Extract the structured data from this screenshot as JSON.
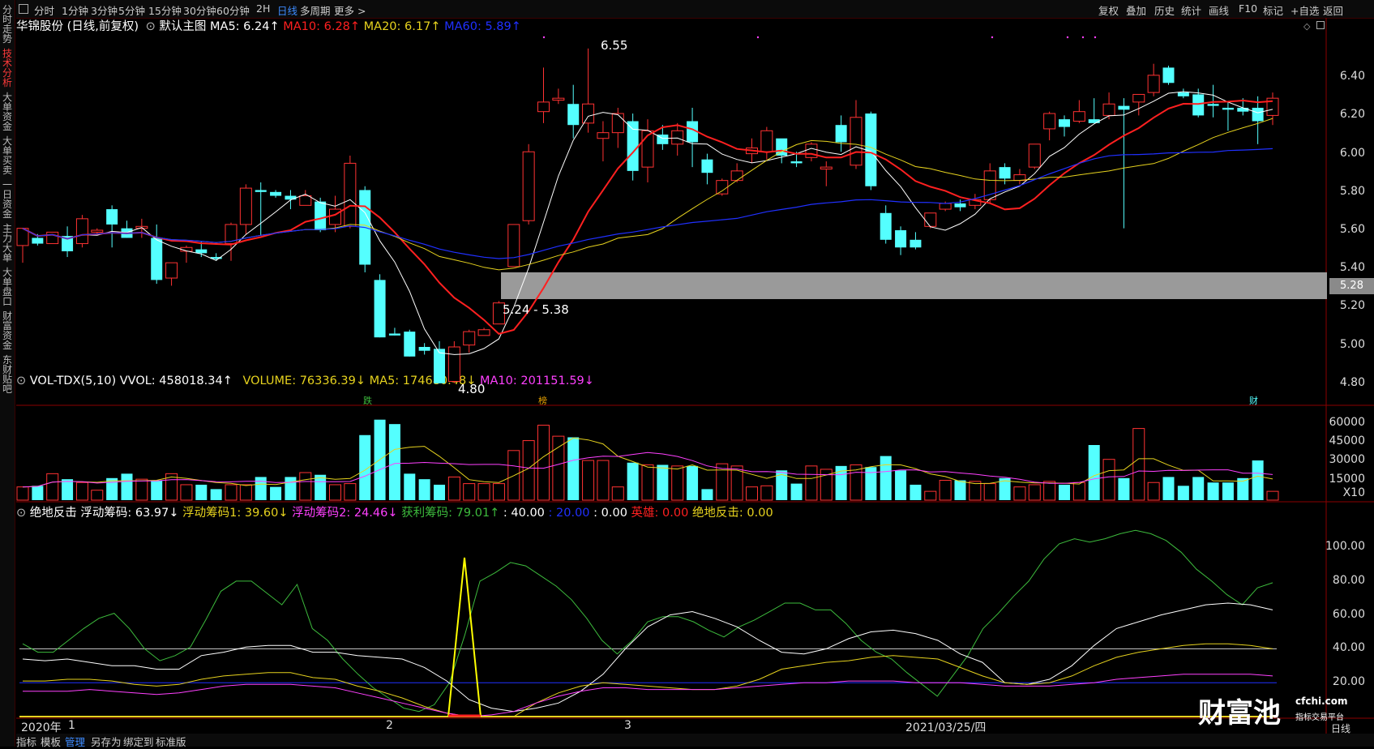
{
  "left_nav": [
    "分时走势",
    "技术分析",
    "大单资金",
    "大单买卖",
    "一日资金",
    "主力大单",
    "大单盘口",
    "财富资金",
    "东财贴吧"
  ],
  "periods": [
    "分时",
    "1分钟",
    "3分钟",
    "5分钟",
    "15分钟",
    "30分钟",
    "60分钟",
    "2H",
    "日线",
    "多周期",
    "更多 >"
  ],
  "active_period": "日线",
  "tools": [
    "复权",
    "叠加",
    "历史",
    "统计",
    "画线",
    "F10",
    "标记",
    "+自选",
    "返回"
  ],
  "header": {
    "stock": "华锦股份 (日线,前复权)",
    "main_label": "默认主图",
    "ma5": "MA5: 6.24↑",
    "ma10": "MA10: 6.28↑",
    "ma20": "MA20: 6.17↑",
    "ma60": "MA60: 5.89↑"
  },
  "vol_header": {
    "name": "VOL-TDX(5,10)",
    "vvol": "VVOL: 458018.34↑",
    "volume": "VOLUME: 76336.39↓",
    "ma5": "MA5: 174680.48↓",
    "ma10": "MA10: 201151.59↓"
  },
  "ind_header": {
    "name": "绝地反击",
    "fdcm": "浮动筹码: 63.97↓",
    "fdcm1": "浮动筹码1: 39.60↓",
    "fdcm2": "浮动筹码2: 24.46↓",
    "hlcm": "获利筹码: 79.01↑",
    "v40": ": 40.00",
    "v20": ": 20.00",
    "v0": ": 0.00",
    "yingxiong": "英雄: 0.00",
    "jdfj": "绝地反击: 0.00"
  },
  "price_axis": [
    "6.40",
    "6.20",
    "6.00",
    "5.80",
    "5.60",
    "5.40",
    "5.20",
    "5.00",
    "4.80"
  ],
  "vol_axis": [
    "60000",
    "45000",
    "30000",
    "15000",
    "X10"
  ],
  "ind_axis": [
    "100.00",
    "80.00",
    "60.00",
    "40.00",
    "20.00"
  ],
  "dates": [
    "2020年",
    "1",
    "2",
    "3",
    "2021/03/25/四"
  ],
  "price_tag": "5.28",
  "annotations": {
    "high": "6.55",
    "low": "4.80",
    "zone": "5.24 - 5.38",
    "mark1": "跌",
    "mark2": "榜",
    "mark3": "财"
  },
  "bottom_tabs": [
    "指标",
    "模板",
    "管理",
    "另存为",
    "绑定到",
    "标准版"
  ],
  "active_bottom": "管理",
  "watermark": {
    "logo": "财富池",
    "site": "cfchi.com",
    "slogan": "指标交易平台"
  },
  "right_mini": "日线",
  "colors": {
    "up": "#ff3232",
    "down": "#54ffff",
    "ma5": "#ffffff",
    "ma10": "#ff2020",
    "ma20": "#e6d21e",
    "ma60": "#2030ff",
    "magenta": "#ff40ff",
    "green": "#3dbb3d"
  },
  "chart_data": {
    "type": "candlestick",
    "title": "华锦股份 (日线,前复权)",
    "candles": [
      {
        "o": 5.52,
        "h": 5.61,
        "l": 5.43,
        "c": 5.61
      },
      {
        "o": 5.56,
        "h": 5.58,
        "l": 5.52,
        "c": 5.53
      },
      {
        "o": 5.53,
        "h": 5.59,
        "l": 5.53,
        "c": 5.59
      },
      {
        "o": 5.57,
        "h": 5.62,
        "l": 5.46,
        "c": 5.49
      },
      {
        "o": 5.53,
        "h": 5.68,
        "l": 5.51,
        "c": 5.66
      },
      {
        "o": 5.59,
        "h": 5.61,
        "l": 5.58,
        "c": 5.6
      },
      {
        "o": 5.71,
        "h": 5.73,
        "l": 5.51,
        "c": 5.63
      },
      {
        "o": 5.61,
        "h": 5.65,
        "l": 5.56,
        "c": 5.56
      },
      {
        "o": 5.61,
        "h": 5.66,
        "l": 5.56,
        "c": 5.62
      },
      {
        "o": 5.56,
        "h": 5.63,
        "l": 5.32,
        "c": 5.34
      },
      {
        "o": 5.35,
        "h": 5.4,
        "l": 5.31,
        "c": 5.43
      },
      {
        "o": 5.49,
        "h": 5.52,
        "l": 5.43,
        "c": 5.51
      },
      {
        "o": 5.5,
        "h": 5.54,
        "l": 5.46,
        "c": 5.48
      },
      {
        "o": 5.46,
        "h": 5.48,
        "l": 5.44,
        "c": 5.45
      },
      {
        "o": 5.53,
        "h": 5.64,
        "l": 5.44,
        "c": 5.63
      },
      {
        "o": 5.63,
        "h": 5.84,
        "l": 5.58,
        "c": 5.82
      },
      {
        "o": 5.81,
        "h": 5.85,
        "l": 5.57,
        "c": 5.8
      },
      {
        "o": 5.8,
        "h": 5.81,
        "l": 5.77,
        "c": 5.78
      },
      {
        "o": 5.78,
        "h": 5.81,
        "l": 5.71,
        "c": 5.76
      },
      {
        "o": 5.73,
        "h": 5.81,
        "l": 5.73,
        "c": 5.78
      },
      {
        "o": 5.75,
        "h": 5.77,
        "l": 5.59,
        "c": 5.6
      },
      {
        "o": 5.63,
        "h": 5.78,
        "l": 5.59,
        "c": 5.71
      },
      {
        "o": 5.62,
        "h": 5.99,
        "l": 5.61,
        "c": 5.95
      },
      {
        "o": 5.81,
        "h": 5.83,
        "l": 5.38,
        "c": 5.42
      },
      {
        "o": 5.34,
        "h": 5.37,
        "l": 5.04,
        "c": 5.04
      },
      {
        "o": 5.06,
        "h": 5.09,
        "l": 5.05,
        "c": 5.05
      },
      {
        "o": 5.07,
        "h": 5.08,
        "l": 4.94,
        "c": 4.94
      },
      {
        "o": 4.99,
        "h": 5.01,
        "l": 4.95,
        "c": 4.97
      },
      {
        "o": 4.98,
        "h": 5.02,
        "l": 4.8,
        "c": 4.8
      },
      {
        "o": 4.81,
        "h": 5.02,
        "l": 4.8,
        "c": 4.99
      },
      {
        "o": 5.0,
        "h": 5.08,
        "l": 4.96,
        "c": 5.07
      },
      {
        "o": 5.05,
        "h": 5.09,
        "l": 5.05,
        "c": 5.08
      },
      {
        "o": 5.11,
        "h": 5.23,
        "l": 5.11,
        "c": 5.22
      },
      {
        "o": 5.41,
        "h": 5.63,
        "l": 5.41,
        "c": 5.63
      },
      {
        "o": 5.65,
        "h": 6.05,
        "l": 5.63,
        "c": 6.01
      },
      {
        "o": 6.22,
        "h": 6.45,
        "l": 6.16,
        "c": 6.27
      },
      {
        "o": 6.28,
        "h": 6.34,
        "l": 6.26,
        "c": 6.29
      },
      {
        "o": 6.26,
        "h": 6.36,
        "l": 6.08,
        "c": 6.15
      },
      {
        "o": 6.16,
        "h": 6.55,
        "l": 6.11,
        "c": 6.26
      },
      {
        "o": 6.08,
        "h": 6.17,
        "l": 5.96,
        "c": 6.11
      },
      {
        "o": 6.11,
        "h": 6.24,
        "l": 6.03,
        "c": 6.21
      },
      {
        "o": 6.17,
        "h": 6.21,
        "l": 5.86,
        "c": 5.91
      },
      {
        "o": 5.93,
        "h": 6.18,
        "l": 5.85,
        "c": 6.12
      },
      {
        "o": 6.1,
        "h": 6.15,
        "l": 6.02,
        "c": 6.05
      },
      {
        "o": 6.05,
        "h": 6.16,
        "l": 5.99,
        "c": 6.12
      },
      {
        "o": 6.17,
        "h": 6.24,
        "l": 5.93,
        "c": 6.06
      },
      {
        "o": 5.97,
        "h": 6.0,
        "l": 5.84,
        "c": 5.9
      },
      {
        "o": 5.79,
        "h": 5.87,
        "l": 5.78,
        "c": 5.86
      },
      {
        "o": 5.86,
        "h": 5.95,
        "l": 5.85,
        "c": 5.91
      },
      {
        "o": 6.0,
        "h": 6.08,
        "l": 5.95,
        "c": 6.03
      },
      {
        "o": 6.01,
        "h": 6.14,
        "l": 5.97,
        "c": 6.12
      },
      {
        "o": 6.08,
        "h": 6.07,
        "l": 5.95,
        "c": 5.99
      },
      {
        "o": 5.96,
        "h": 6.01,
        "l": 5.93,
        "c": 5.95
      },
      {
        "o": 5.98,
        "h": 6.06,
        "l": 5.96,
        "c": 6.05
      },
      {
        "o": 5.92,
        "h": 5.96,
        "l": 5.83,
        "c": 5.93
      },
      {
        "o": 6.15,
        "h": 6.2,
        "l": 6.01,
        "c": 6.06
      },
      {
        "o": 5.94,
        "h": 6.28,
        "l": 5.92,
        "c": 6.19
      },
      {
        "o": 6.21,
        "h": 6.22,
        "l": 5.81,
        "c": 5.83
      },
      {
        "o": 5.69,
        "h": 5.73,
        "l": 5.53,
        "c": 5.55
      },
      {
        "o": 5.6,
        "h": 5.62,
        "l": 5.47,
        "c": 5.51
      },
      {
        "o": 5.55,
        "h": 5.59,
        "l": 5.5,
        "c": 5.51
      },
      {
        "o": 5.62,
        "h": 5.69,
        "l": 5.61,
        "c": 5.69
      },
      {
        "o": 5.71,
        "h": 5.75,
        "l": 5.7,
        "c": 5.74
      },
      {
        "o": 5.74,
        "h": 5.76,
        "l": 5.7,
        "c": 5.72
      },
      {
        "o": 5.73,
        "h": 5.79,
        "l": 5.71,
        "c": 5.76
      },
      {
        "o": 5.76,
        "h": 5.95,
        "l": 5.74,
        "c": 5.91
      },
      {
        "o": 5.93,
        "h": 5.95,
        "l": 5.84,
        "c": 5.87
      },
      {
        "o": 5.86,
        "h": 5.92,
        "l": 5.84,
        "c": 5.89
      },
      {
        "o": 5.93,
        "h": 6.05,
        "l": 5.92,
        "c": 6.05
      },
      {
        "o": 6.13,
        "h": 6.22,
        "l": 6.07,
        "c": 6.21
      },
      {
        "o": 6.18,
        "h": 6.2,
        "l": 6.09,
        "c": 6.14
      },
      {
        "o": 6.17,
        "h": 6.28,
        "l": 6.16,
        "c": 6.22
      },
      {
        "o": 6.18,
        "h": 6.29,
        "l": 6.16,
        "c": 6.16
      },
      {
        "o": 6.2,
        "h": 6.32,
        "l": 6.18,
        "c": 6.26
      },
      {
        "o": 6.25,
        "h": 6.29,
        "l": 5.61,
        "c": 6.23
      },
      {
        "o": 6.27,
        "h": 6.29,
        "l": 6.2,
        "c": 6.31
      },
      {
        "o": 6.32,
        "h": 6.47,
        "l": 6.3,
        "c": 6.41
      },
      {
        "o": 6.45,
        "h": 6.46,
        "l": 6.36,
        "c": 6.37
      },
      {
        "o": 6.32,
        "h": 6.34,
        "l": 6.29,
        "c": 6.3
      },
      {
        "o": 6.31,
        "h": 6.34,
        "l": 6.19,
        "c": 6.2
      },
      {
        "o": 6.26,
        "h": 6.36,
        "l": 6.19,
        "c": 6.25
      },
      {
        "o": 6.24,
        "h": 6.27,
        "l": 6.12,
        "c": 6.23
      },
      {
        "o": 6.24,
        "h": 6.29,
        "l": 6.2,
        "c": 6.22
      },
      {
        "o": 6.24,
        "h": 6.3,
        "l": 6.05,
        "c": 6.17
      },
      {
        "o": 6.2,
        "h": 6.32,
        "l": 6.15,
        "c": 6.29
      }
    ],
    "volume": [
      12,
      13,
      24,
      19,
      16,
      9,
      20,
      24,
      19,
      18,
      24,
      14,
      14,
      10,
      14,
      14,
      21,
      12,
      21,
      25,
      23,
      14,
      15,
      59,
      73,
      69,
      24,
      19,
      14,
      21,
      15,
      15,
      15,
      45,
      54,
      68,
      58,
      57,
      36,
      36,
      12,
      34,
      32,
      32,
      31,
      31,
      10,
      33,
      31,
      12,
      13,
      27,
      15,
      31,
      28,
      31,
      32,
      30,
      40,
      27,
      14,
      8,
      18,
      18,
      17,
      15,
      20,
      12,
      14,
      17,
      14,
      16,
      50,
      37,
      20,
      65,
      16,
      21,
      13,
      21,
      16,
      16,
      20,
      36,
      8
    ],
    "indicator": {
      "white": [
        34,
        33,
        34,
        32,
        30,
        30,
        28,
        28,
        36,
        38,
        41,
        42,
        42,
        38,
        38,
        36,
        35,
        34,
        29,
        21,
        10,
        5,
        3,
        5,
        8,
        15,
        25,
        40,
        53,
        60,
        62,
        58,
        53,
        45,
        38,
        37,
        40,
        46,
        50,
        51,
        49,
        45,
        37,
        32,
        20,
        19,
        22,
        30,
        42,
        52,
        56,
        60,
        63,
        66,
        67,
        66,
        63
      ],
      "yellow": [
        21,
        21,
        22,
        22,
        21,
        19,
        18,
        19,
        22,
        24,
        25,
        26,
        26,
        23,
        22,
        18,
        15,
        11,
        6,
        2,
        0,
        0,
        0,
        8,
        14,
        18,
        20,
        19,
        18,
        17,
        16,
        16,
        18,
        22,
        28,
        30,
        32,
        33,
        35,
        36,
        35,
        34,
        29,
        24,
        20,
        19,
        20,
        24,
        30,
        35,
        38,
        40,
        42,
        43,
        43,
        42,
        40
      ],
      "magenta": [
        15,
        15,
        15,
        16,
        15,
        14,
        13,
        14,
        16,
        18,
        19,
        19,
        19,
        18,
        17,
        14,
        11,
        8,
        5,
        2,
        0,
        1,
        3,
        8,
        12,
        15,
        17,
        17,
        16,
        16,
        16,
        16,
        17,
        18,
        19,
        20,
        20,
        21,
        21,
        21,
        20,
        20,
        20,
        19,
        18,
        18,
        18,
        19,
        20,
        22,
        23,
        24,
        25,
        25,
        25,
        25,
        24
      ],
      "green": [
        43,
        38,
        38,
        45,
        52,
        58,
        61,
        52,
        40,
        33,
        36,
        41,
        57,
        74,
        80,
        80,
        73,
        66,
        78,
        52,
        45,
        34,
        25,
        17,
        11,
        5,
        3,
        7,
        20,
        48,
        80,
        85,
        91,
        89,
        83,
        77,
        69,
        58,
        45,
        37,
        45,
        56,
        59,
        59,
        56,
        51,
        47,
        53,
        57,
        62,
        67,
        67,
        63,
        63,
        55,
        45,
        38,
        34,
        26,
        19,
        12,
        24,
        36,
        52,
        61,
        71,
        80,
        93,
        102,
        105,
        103,
        105,
        108,
        110,
        108,
        104,
        97,
        87,
        80,
        72,
        66,
        76,
        79
      ]
    },
    "ma_latest": {
      "ma5": 6.24,
      "ma10": 6.28,
      "ma20": 6.17,
      "ma60": 5.89
    },
    "ylim": [
      4.74,
      6.6
    ]
  }
}
